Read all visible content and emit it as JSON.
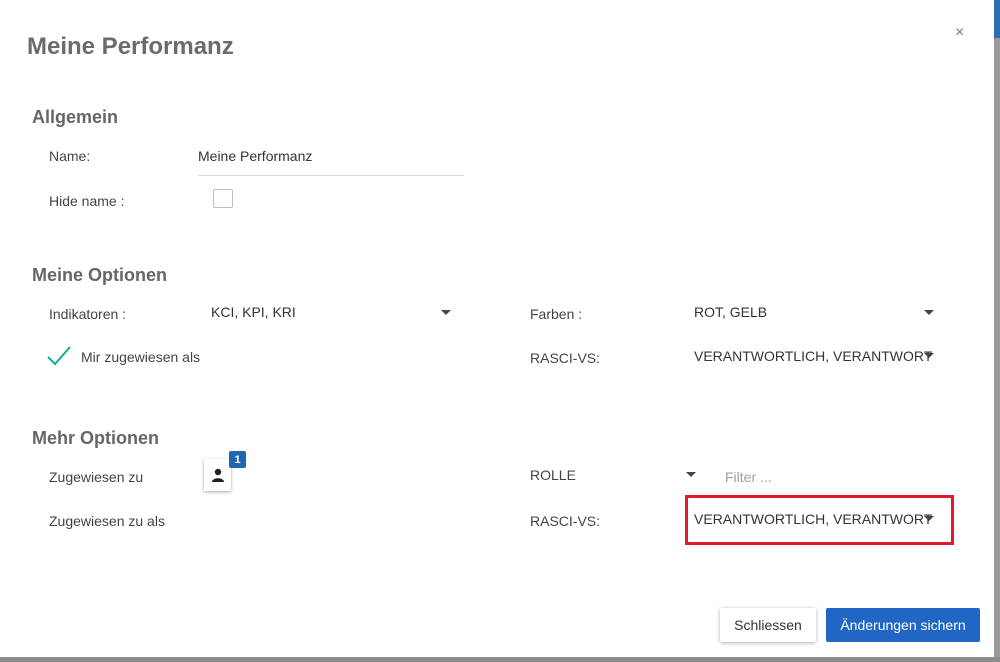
{
  "dialog": {
    "title": "Meine Performanz",
    "close_glyph": "×"
  },
  "general": {
    "heading": "Allgemein",
    "name_label": "Name:",
    "name_value": "Meine Performanz",
    "hide_name_label": "Hide name :",
    "hide_name_checked": false
  },
  "my_options": {
    "heading": "Meine Optionen",
    "indicators_label": "Indikatoren :",
    "indicators_value": "KCI, KPI, KRI",
    "colors_label": "Farben :",
    "colors_value": "ROT, GELB",
    "assigned_check_label": "Mir zugewiesen als",
    "assigned_checked": true,
    "rasci_label": "RASCI-VS:",
    "rasci_value": "VERANTWORTLICH, VERANTWORT"
  },
  "more_options": {
    "heading": "Mehr Optionen",
    "assigned_to_label": "Zugewiesen zu",
    "assigned_badge": "1",
    "role_label": "ROLLE",
    "filter_placeholder": "Filter ...",
    "assigned_as_label": "Zugewiesen zu als",
    "rasci_label": "RASCI-VS:",
    "rasci_value": "VERANTWORTLICH, VERANTWORT"
  },
  "footer": {
    "close_label": "Schliessen",
    "save_label": "Änderungen sichern"
  },
  "colors": {
    "primary": "#2166c4",
    "highlight": "#e21a2c",
    "check": "#1aa89a"
  },
  "icons": [
    "close-icon",
    "checkmark-icon",
    "caret-down-icon",
    "user-icon"
  ]
}
